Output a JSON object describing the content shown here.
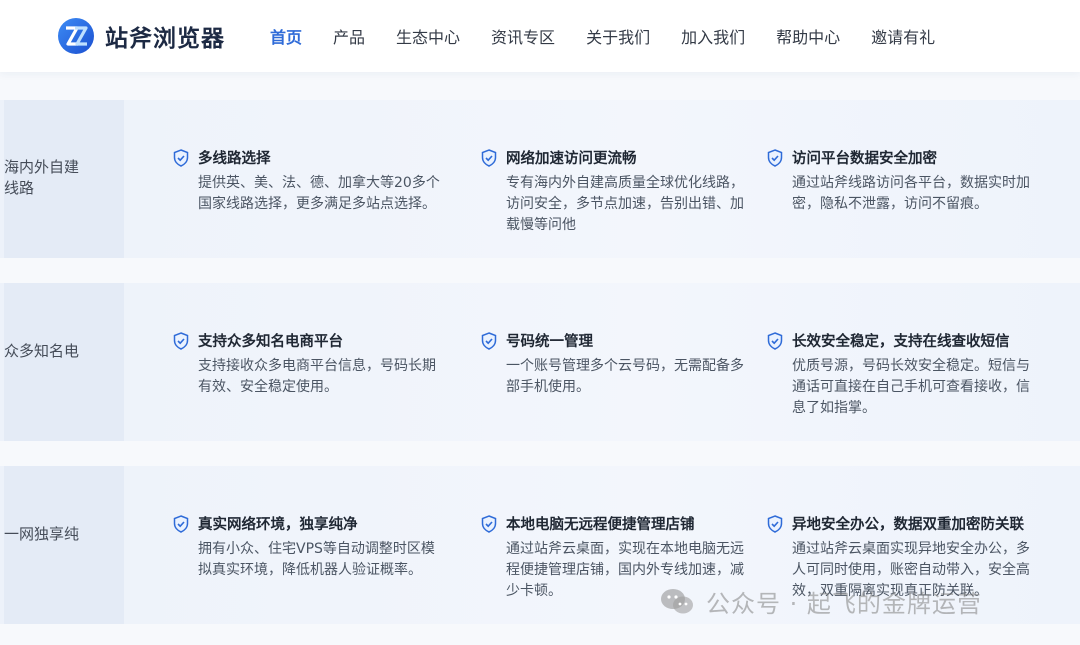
{
  "brand": {
    "name": "站斧浏览器",
    "accent": "#2f6bd8"
  },
  "nav": {
    "items": [
      {
        "label": "首页",
        "active": true
      },
      {
        "label": "产品"
      },
      {
        "label": "生态中心"
      },
      {
        "label": "资讯专区"
      },
      {
        "label": "关于我们"
      },
      {
        "label": "加入我们"
      },
      {
        "label": "帮助中心"
      },
      {
        "label": "邀请有礼"
      }
    ]
  },
  "rows": [
    {
      "label_lines": [
        "海内外自建",
        "线路"
      ],
      "cards": [
        {
          "icon": "shield-check-icon",
          "title": "多线路选择",
          "desc": "提供英、美、法、德、加拿大等20多个国家线路选择，更多满足多站点选择。"
        },
        {
          "icon": "shield-check-icon",
          "title": "网络加速访问更流畅",
          "desc": "专有海内外自建高质量全球优化线路，访问安全，多节点加速，告别出错、加载慢等问他"
        },
        {
          "icon": "shield-check-icon",
          "title": "访问平台数据安全加密",
          "desc": "通过站斧线路访问各平台，数据实时加密，隐私不泄露，访问不留痕。"
        }
      ]
    },
    {
      "label_lines": [
        "众多知名电"
      ],
      "cards": [
        {
          "icon": "shield-check-icon",
          "title": "支持众多知名电商平台",
          "desc": "支持接收众多电商平台信息，号码长期有效、安全稳定使用。"
        },
        {
          "icon": "shield-check-icon",
          "title": "号码统一管理",
          "desc": "一个账号管理多个云号码，无需配备多部手机使用。"
        },
        {
          "icon": "shield-check-icon",
          "title": "长效安全稳定，支持在线查收短信",
          "desc": "优质号源，号码长效安全稳定。短信与通话可直接在自己手机可查看接收，信息了如指掌。"
        }
      ]
    },
    {
      "label_lines": [
        "一网独享纯"
      ],
      "cards": [
        {
          "icon": "shield-check-icon",
          "title": "真实网络环境，独享纯净",
          "desc": "拥有小众、住宅VPS等自动调整时区模拟真实环境，降低机器人验证概率。"
        },
        {
          "icon": "shield-check-icon",
          "title": "本地电脑无远程便捷管理店铺",
          "desc": "通过站斧云桌面，实现在本地电脑无远程便捷管理店铺，国内外专线加速，减少卡顿。"
        },
        {
          "icon": "shield-check-icon",
          "title": "异地安全办公，数据双重加密防关联",
          "desc": "通过站斧云桌面实现异地安全办公，多人可同时使用，账密自动带入，安全高效，双重隔离实现真正防关联。"
        }
      ]
    }
  ],
  "watermark": {
    "text": "公众号 · 起飞的金牌运营",
    "icon": "wechat-icon"
  }
}
